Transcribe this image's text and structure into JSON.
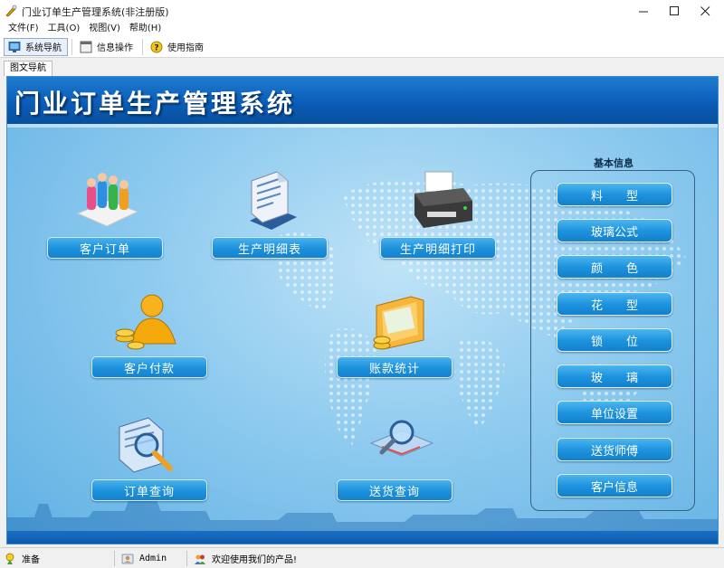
{
  "window": {
    "title": "门业订单生产管理系统(非注册版)"
  },
  "menu": [
    {
      "label": "文件(F)"
    },
    {
      "label": "工具(O)"
    },
    {
      "label": "视图(V)"
    },
    {
      "label": "帮助(H)"
    }
  ],
  "toolbar": {
    "system_nav": "系统导航",
    "info_ops": "信息操作",
    "guide": "使用指南"
  },
  "tab": {
    "label": "图文导航"
  },
  "banner": {
    "title": "门业订单生产管理系统"
  },
  "modules": {
    "customer_order": "客户订单",
    "production_detail": "生产明细表",
    "production_print": "生产明细打印",
    "customer_payment": "客户付款",
    "account_stats": "账款统计",
    "order_query": "订单查询",
    "delivery_query": "送货查询"
  },
  "basic_info": {
    "heading": "基本信息",
    "items": [
      "料　　型",
      "玻璃公式",
      "颜　　色",
      "花　　型",
      "锁　　位",
      "玻　　璃",
      "单位设置",
      "送货师傅",
      "客户信息"
    ]
  },
  "status": {
    "state": "准备",
    "user": "Admin",
    "message": "欢迎使用我们的产品!"
  },
  "colors": {
    "banner": "#0b5db8",
    "button": "#1f93dd",
    "panel_bg": "#8fcbef"
  }
}
